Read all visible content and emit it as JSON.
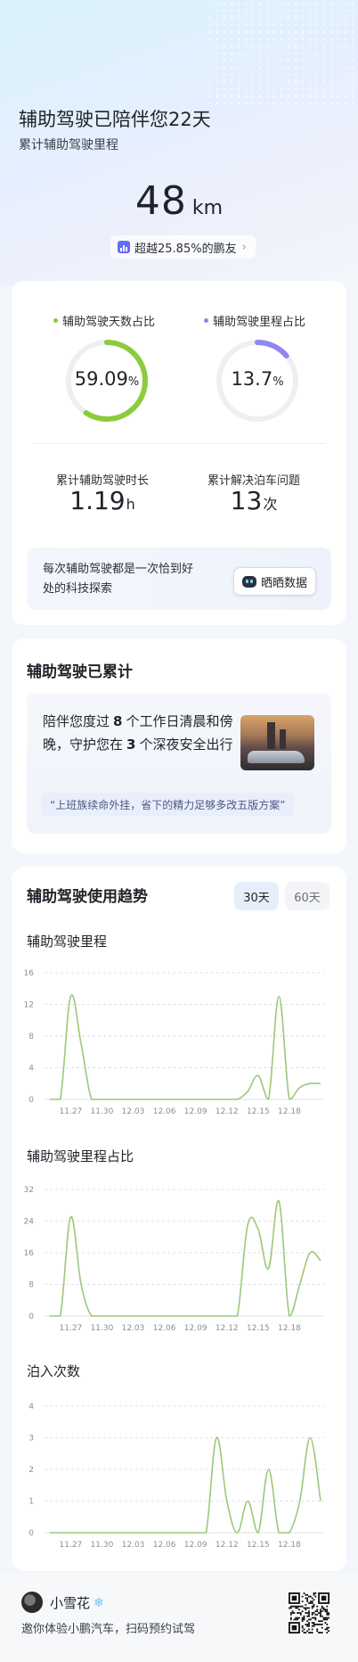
{
  "hero": {
    "title": "辅助驾驶已陪伴您22天",
    "subtitle": "累计辅助驾驶里程",
    "km_value": "48",
    "km_unit": "km",
    "rank_text": "超越25.85%的鹏友",
    "rank_icon": "bar-chart-icon",
    "chevron": "›"
  },
  "rings": [
    {
      "label": "辅助驾驶天数占比",
      "value": "59.09",
      "unit": "%",
      "percent": 59.09,
      "color": "#8ccc3c",
      "dot_color": "#8ccc3c"
    },
    {
      "label": "辅助驾驶里程占比",
      "value": "13.7",
      "unit": "%",
      "percent": 13.7,
      "color": "#8f86f0",
      "dot_color": "#8f86f0"
    }
  ],
  "stats": [
    {
      "label": "累计辅助驾驶时长",
      "value": "1.19",
      "unit": "h"
    },
    {
      "label": "累计解决泊车问题",
      "value": "13",
      "unit": "次"
    }
  ],
  "share": {
    "text": "每次辅助驾驶都是一次恰到好处的科技探索",
    "button": "晒晒数据"
  },
  "accumulated": {
    "title": "辅助驾驶已累计",
    "line_a": "陪伴您度过",
    "workdays": "8",
    "line_b": "个工作日清晨和傍晚，守护您在",
    "nights": "3",
    "line_c": "个深夜安全出行",
    "quote": "“上班族续命外挂，省下的精力足够多改五版方案”"
  },
  "trend": {
    "title": "辅助驾驶使用趋势",
    "seg_on": "30天",
    "seg_off": "60天"
  },
  "chart_data": [
    {
      "type": "line",
      "title": "辅助驾驶里程",
      "color": "#9bc97a",
      "ylim": [
        0,
        16
      ],
      "yticks": [
        0,
        4,
        8,
        12,
        16
      ],
      "xticks": [
        "11.27",
        "11.30",
        "12.03",
        "12.06",
        "12.09",
        "12.12",
        "12.15",
        "12.18"
      ],
      "points": [
        [
          0,
          0
        ],
        [
          1,
          0
        ],
        [
          2,
          13
        ],
        [
          3,
          7
        ],
        [
          4,
          0
        ],
        [
          5,
          0
        ],
        [
          6,
          0
        ],
        [
          7,
          0
        ],
        [
          8,
          0
        ],
        [
          9,
          0
        ],
        [
          10,
          0
        ],
        [
          11,
          0
        ],
        [
          12,
          0
        ],
        [
          13,
          0
        ],
        [
          14,
          0
        ],
        [
          15,
          0
        ],
        [
          16,
          0
        ],
        [
          17,
          0
        ],
        [
          18,
          0
        ],
        [
          19,
          1
        ],
        [
          20,
          3
        ],
        [
          21,
          0
        ],
        [
          22,
          13
        ],
        [
          23,
          0
        ],
        [
          24,
          1.5
        ],
        [
          25,
          2
        ],
        [
          26,
          2
        ]
      ]
    },
    {
      "type": "line",
      "title": "辅助驾驶里程占比",
      "color": "#9bc97a",
      "ylim": [
        0,
        32
      ],
      "yticks": [
        0,
        8,
        16,
        24,
        32
      ],
      "xticks": [
        "11.27",
        "11.30",
        "12.03",
        "12.06",
        "12.09",
        "12.12",
        "12.15",
        "12.18"
      ],
      "points": [
        [
          0,
          0
        ],
        [
          1,
          0
        ],
        [
          2,
          25
        ],
        [
          3,
          8
        ],
        [
          4,
          0
        ],
        [
          5,
          0
        ],
        [
          6,
          0
        ],
        [
          7,
          0
        ],
        [
          8,
          0
        ],
        [
          9,
          0
        ],
        [
          10,
          0
        ],
        [
          11,
          0
        ],
        [
          12,
          0
        ],
        [
          13,
          0
        ],
        [
          14,
          0
        ],
        [
          15,
          0
        ],
        [
          16,
          0
        ],
        [
          17,
          0
        ],
        [
          18,
          0
        ],
        [
          19,
          23
        ],
        [
          20,
          22
        ],
        [
          21,
          12
        ],
        [
          22,
          29
        ],
        [
          23,
          0
        ],
        [
          24,
          8
        ],
        [
          25,
          16
        ],
        [
          26,
          14
        ]
      ]
    },
    {
      "type": "line",
      "title": "泊入次数",
      "color": "#9bc97a",
      "ylim": [
        0,
        4
      ],
      "yticks": [
        0,
        1,
        2,
        3,
        4
      ],
      "xticks": [
        "11.27",
        "11.30",
        "12.03",
        "12.06",
        "12.09",
        "12.12",
        "12.15",
        "12.18"
      ],
      "points": [
        [
          0,
          0
        ],
        [
          1,
          0
        ],
        [
          2,
          0
        ],
        [
          3,
          0
        ],
        [
          4,
          0
        ],
        [
          5,
          0
        ],
        [
          6,
          0
        ],
        [
          7,
          0
        ],
        [
          8,
          0
        ],
        [
          9,
          0
        ],
        [
          10,
          0
        ],
        [
          11,
          0
        ],
        [
          12,
          0
        ],
        [
          13,
          0
        ],
        [
          14,
          0
        ],
        [
          15,
          0
        ],
        [
          16,
          3
        ],
        [
          17,
          1
        ],
        [
          18,
          0
        ],
        [
          19,
          1
        ],
        [
          20,
          0
        ],
        [
          21,
          2
        ],
        [
          22,
          0
        ],
        [
          23,
          0
        ],
        [
          24,
          1
        ],
        [
          25,
          3
        ],
        [
          26,
          1
        ]
      ]
    }
  ],
  "footer": {
    "user_name": "小雪花",
    "badge": "❄",
    "invite": "邀你体验小鹏汽车，扫码预约试驾"
  }
}
